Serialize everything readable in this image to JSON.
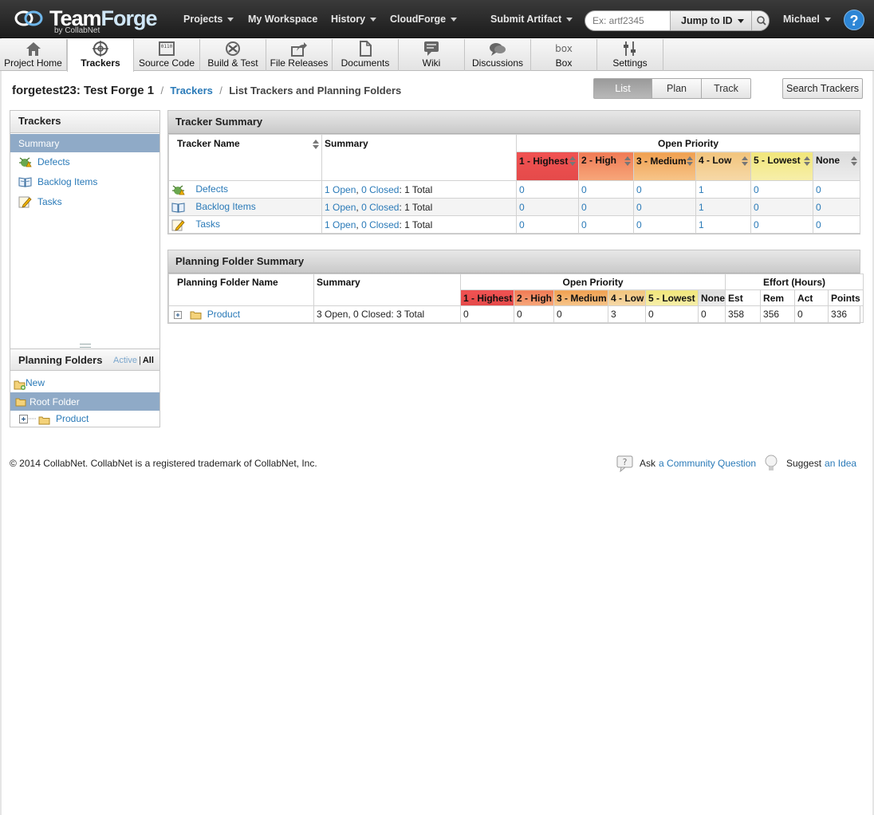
{
  "brand": {
    "name_team": "Team",
    "name_forge": "Forge",
    "sub": "by CollabNet"
  },
  "topnav": {
    "projects": "Projects",
    "workspace": "My Workspace",
    "history": "History",
    "cloudforge": "CloudForge",
    "submit": "Submit Artifact",
    "search_placeholder": "Ex: artf2345",
    "jump": "Jump to ID",
    "user": "Michael",
    "help": "?"
  },
  "toolbar": {
    "items": [
      {
        "label": "Project Home"
      },
      {
        "label": "Trackers"
      },
      {
        "label": "Source Code"
      },
      {
        "label": "Build & Test"
      },
      {
        "label": "File Releases"
      },
      {
        "label": "Documents"
      },
      {
        "label": "Wiki"
      },
      {
        "label": "Discussions"
      },
      {
        "label": "Box"
      },
      {
        "label": "Settings"
      }
    ],
    "box_logo": "box",
    "source_code_glyph": "0110"
  },
  "breadcrumb": {
    "project": "forgetest23: Test Forge 1",
    "sep": "/",
    "trackers": "Trackers",
    "current": "List Trackers and Planning Folders"
  },
  "viewtabs": {
    "list": "List",
    "plan": "Plan",
    "track": "Track"
  },
  "search_trackers": "Search Trackers",
  "sidebar": {
    "title": "Trackers",
    "summary": "Summary",
    "items": [
      {
        "label": "Defects"
      },
      {
        "label": "Backlog Items"
      },
      {
        "label": "Tasks"
      }
    ],
    "planning": {
      "title": "Planning Folders",
      "active": "Active",
      "sep": "|",
      "all": "All",
      "new": "New",
      "root": "Root Folder",
      "product": "Product"
    }
  },
  "tracker_summary": {
    "title": "Tracker Summary",
    "headers": {
      "name": "Tracker Name",
      "summary": "Summary",
      "open_priority": "Open Priority",
      "p1": "1 - Highest",
      "p2": "2 - High",
      "p3": "3 - Medium",
      "p4": "4 - Low",
      "p5": "5 - Lowest",
      "p0": "None"
    },
    "rows": [
      {
        "name": "Defects",
        "open": "1 Open",
        "comma": ",",
        "closed": "0 Closed",
        "total": ": 1 Total",
        "p1": "0",
        "p2": "0",
        "p3": "0",
        "p4": "1",
        "p5": "0",
        "p0": "0"
      },
      {
        "name": "Backlog Items",
        "open": "1 Open",
        "comma": ",",
        "closed": "0 Closed",
        "total": ": 1 Total",
        "p1": "0",
        "p2": "0",
        "p3": "0",
        "p4": "1",
        "p5": "0",
        "p0": "0"
      },
      {
        "name": "Tasks",
        "open": "1 Open",
        "comma": ",",
        "closed": "0 Closed",
        "total": ": 1 Total",
        "p1": "0",
        "p2": "0",
        "p3": "0",
        "p4": "1",
        "p5": "0",
        "p0": "0"
      }
    ]
  },
  "planning_summary": {
    "title": "Planning Folder Summary",
    "headers": {
      "name": "Planning Folder Name",
      "summary": "Summary",
      "open_priority": "Open Priority",
      "effort": "Effort (Hours)",
      "p1": "1 - Highest",
      "p2": "2 - High",
      "p3": "3 - Medium",
      "p4": "4 - Low",
      "p5": "5 - Lowest",
      "p0": "None",
      "est": "Est",
      "rem": "Rem",
      "act": "Act",
      "points": "Points"
    },
    "rows": [
      {
        "name": "Product",
        "summary": "3 Open, 0 Closed: 3 Total",
        "p1": "0",
        "p2": "0",
        "p3": "0",
        "p4": "3",
        "p5": "0",
        "p0": "0",
        "est": "358",
        "rem": "356",
        "act": "0",
        "points": "336"
      }
    ]
  },
  "footer": {
    "copyright": "© 2014 CollabNet. CollabNet is a registered trademark of CollabNet, Inc.",
    "ask": "Ask",
    "ask_link": "a Community Question",
    "suggest": "Suggest",
    "suggest_link": "an Idea"
  },
  "colors": {
    "accent": "#2a7ab8",
    "selection": "#8faac7",
    "p1": "#e44a4a",
    "p2": "#f39268",
    "p3": "#f3b26c",
    "p4": "#f4cf92",
    "p5": "#f4ea93",
    "none": "#e4e4e4"
  }
}
